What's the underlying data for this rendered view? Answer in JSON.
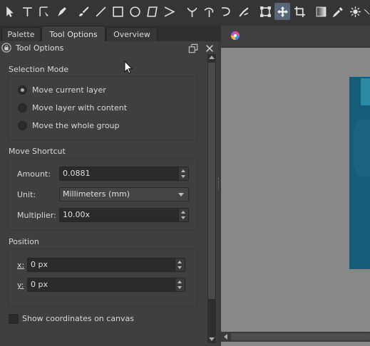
{
  "tabs": [
    {
      "label": "Palette"
    },
    {
      "label": "Tool Options"
    },
    {
      "label": "Overview"
    }
  ],
  "docker": {
    "title": "Tool Options"
  },
  "selection_mode": {
    "title": "Selection Mode",
    "options": [
      {
        "label": "Move current layer",
        "checked": true
      },
      {
        "label": "Move layer with content",
        "checked": false
      },
      {
        "label": "Move the whole group",
        "checked": false
      }
    ]
  },
  "move_shortcut": {
    "title": "Move Shortcut",
    "amount_label": "Amount:",
    "amount_value": "0.0881",
    "unit_label": "Unit:",
    "unit_value": "Millimeters (mm)",
    "multiplier_label": "Multiplier:",
    "multiplier_value": "10.00x"
  },
  "position": {
    "title": "Position",
    "x_label": "x:",
    "x_value": "0 px",
    "y_label": "y:",
    "y_value": "0 px"
  },
  "show_coordinates": {
    "label": "Show coordinates on canvas",
    "checked": false
  },
  "colors": {
    "active_tool": "#59677a",
    "canvas_image": "#145c78"
  },
  "toolbar_icons": [
    "select-shapes",
    "text",
    "edit-shapes",
    "calligraphy",
    "brush",
    "line",
    "rectangle",
    "ellipse",
    "polygon",
    "polyline",
    "bezier-curve",
    "freehand-path",
    "dynamic-brush",
    "multibrush",
    "transform",
    "move",
    "crop",
    "gradient",
    "color-sampler",
    "smart-patch"
  ]
}
